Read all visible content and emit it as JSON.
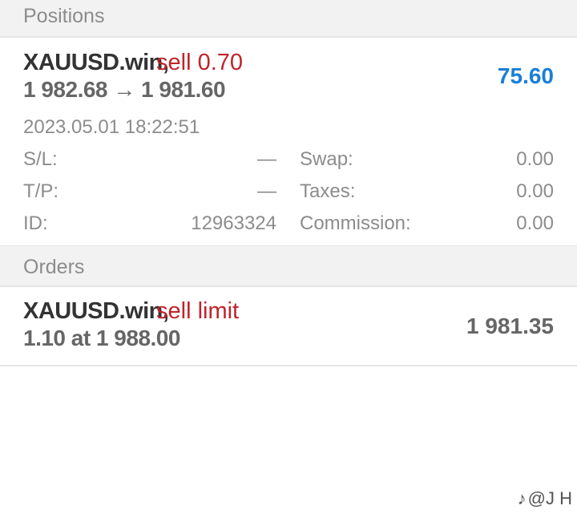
{
  "positions": {
    "header": "Positions",
    "item": {
      "symbol": "XAUUSD.win,",
      "side": "sell 0.70",
      "prices": "1 982.68 → 1 981.60",
      "profit": "75.60",
      "profit_color": "#1a7fd6",
      "time": "2023.05.01 18:22:51",
      "sl_label": "S/L:",
      "sl_value": "—",
      "tp_label": "T/P:",
      "tp_value": "—",
      "id_label": "ID:",
      "id_value": "12963324",
      "swap_label": "Swap:",
      "swap_value": "0.00",
      "taxes_label": "Taxes:",
      "taxes_value": "0.00",
      "commission_label": "Commission:",
      "commission_value": "0.00"
    }
  },
  "orders": {
    "header": "Orders",
    "item": {
      "symbol": "XAUUSD.win,",
      "side": "sell limit",
      "volume_price": "1.10 at 1 988.00",
      "current_price": "1 981.35"
    }
  },
  "watermark": "@J H"
}
